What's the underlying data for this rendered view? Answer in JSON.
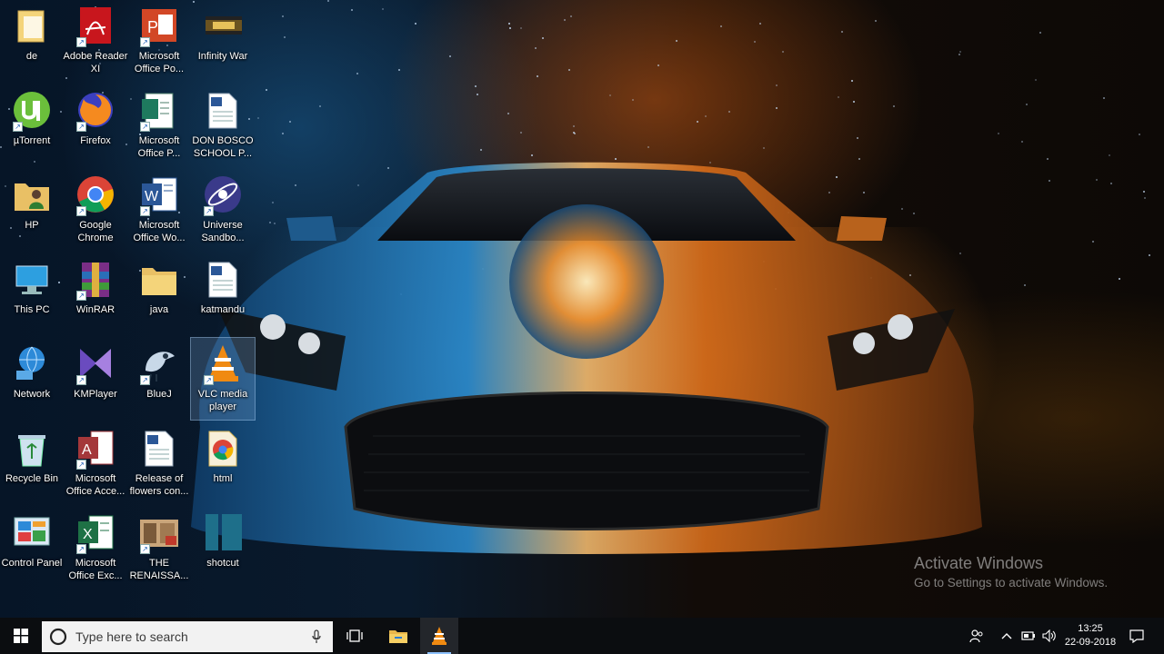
{
  "desktop": {
    "icons": [
      {
        "label": "de",
        "icon": "folder-file-icon"
      },
      {
        "label": "Adobe Reader XI",
        "icon": "adobe-reader-icon"
      },
      {
        "label": "Microsoft Office Po...",
        "icon": "powerpoint-icon"
      },
      {
        "label": "Infinity War",
        "icon": "video-thumbnail-icon"
      },
      {
        "label": "µTorrent",
        "icon": "utorrent-icon"
      },
      {
        "label": "Firefox",
        "icon": "firefox-icon"
      },
      {
        "label": "Microsoft Office P...",
        "icon": "publisher-icon"
      },
      {
        "label": "DON BOSCO SCHOOL P...",
        "icon": "word-document-icon"
      },
      {
        "label": "HP",
        "icon": "user-folder-icon"
      },
      {
        "label": "Google Chrome",
        "icon": "chrome-icon"
      },
      {
        "label": "Microsoft Office Wo...",
        "icon": "word-icon"
      },
      {
        "label": "Universe Sandbo...",
        "icon": "universe-sandbox-icon"
      },
      {
        "label": "This PC",
        "icon": "this-pc-icon"
      },
      {
        "label": "WinRAR",
        "icon": "winrar-icon"
      },
      {
        "label": "java",
        "icon": "folder-icon"
      },
      {
        "label": "katmandu",
        "icon": "word-document-icon"
      },
      {
        "label": "Network",
        "icon": "network-icon"
      },
      {
        "label": "KMPlayer",
        "icon": "kmplayer-icon"
      },
      {
        "label": "BlueJ",
        "icon": "bluej-icon"
      },
      {
        "label": "VLC media player",
        "icon": "vlc-icon"
      },
      {
        "label": "Recycle Bin",
        "icon": "recycle-bin-icon"
      },
      {
        "label": "Microsoft Office Acce...",
        "icon": "access-icon"
      },
      {
        "label": "Release of flowers con...",
        "icon": "word-document-icon"
      },
      {
        "label": "html",
        "icon": "chrome-html-icon"
      },
      {
        "label": "Control Panel",
        "icon": "control-panel-icon"
      },
      {
        "label": "Microsoft Office Exc...",
        "icon": "excel-icon"
      },
      {
        "label": "THE RENAISSA...",
        "icon": "image-thumbnail-icon"
      },
      {
        "label": "shotcut",
        "icon": "shotcut-icon"
      }
    ],
    "selected": "VLC media player"
  },
  "watermark": {
    "title": "Activate Windows",
    "subtitle": "Go to Settings to activate Windows."
  },
  "taskbar": {
    "search_placeholder": "Type here to search",
    "time": "13:25",
    "date": "22-09-2018",
    "pinned": [
      "file-explorer-icon",
      "vlc-icon"
    ]
  },
  "colors": {
    "taskbar": "#0b0d10",
    "accent_blue": "#1e78c8",
    "accent_orange": "#e8801e"
  }
}
